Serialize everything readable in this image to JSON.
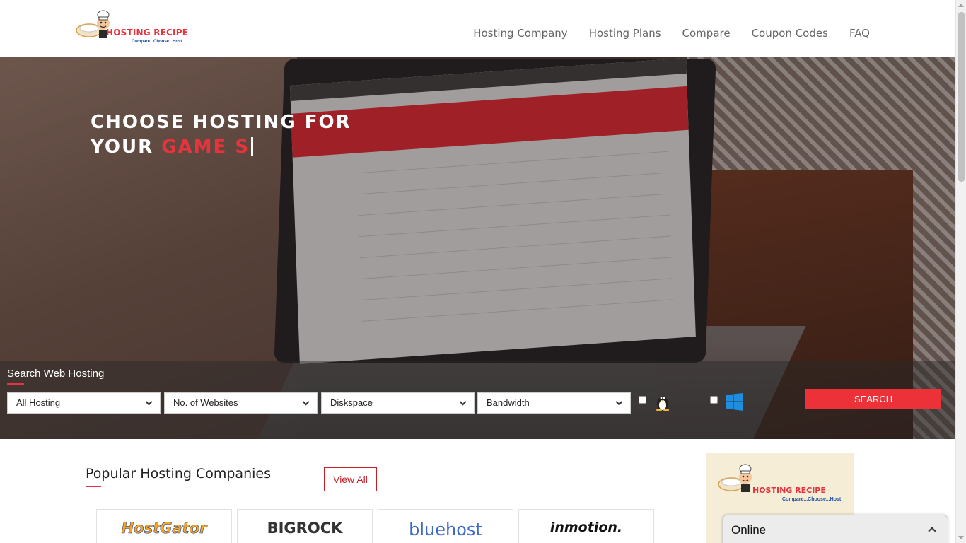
{
  "logo": {
    "name": "HOSTING RECIPE",
    "tagline": "Compare...Choose...Host"
  },
  "nav": {
    "items": [
      "Hosting Company",
      "Hosting Plans",
      "Compare",
      "Coupon Codes",
      "FAQ"
    ]
  },
  "hero": {
    "line1": "CHOOSE HOSTING FOR",
    "line2_prefix": "YOUR",
    "line2_accent": "GAME S"
  },
  "search": {
    "title": "Search Web Hosting",
    "filters": [
      "All Hosting",
      "No. of Websites",
      "Diskspace",
      "Bandwidth"
    ],
    "os_options": [
      "linux-icon",
      "windows-icon"
    ],
    "button_label": "SEARCH"
  },
  "popular": {
    "title": "Popular Hosting Companies",
    "view_all": "View All",
    "companies": [
      "HostGator",
      "BIGROCK",
      "bluehost",
      "inmotion."
    ]
  },
  "ad": {
    "name": "HOSTING RECIPE",
    "tagline": "Compare...Choose...Host"
  },
  "chat": {
    "status": "Online"
  },
  "colors": {
    "accent": "#e8333d",
    "button": "#ec3139",
    "tagline": "#1e4fa1"
  }
}
